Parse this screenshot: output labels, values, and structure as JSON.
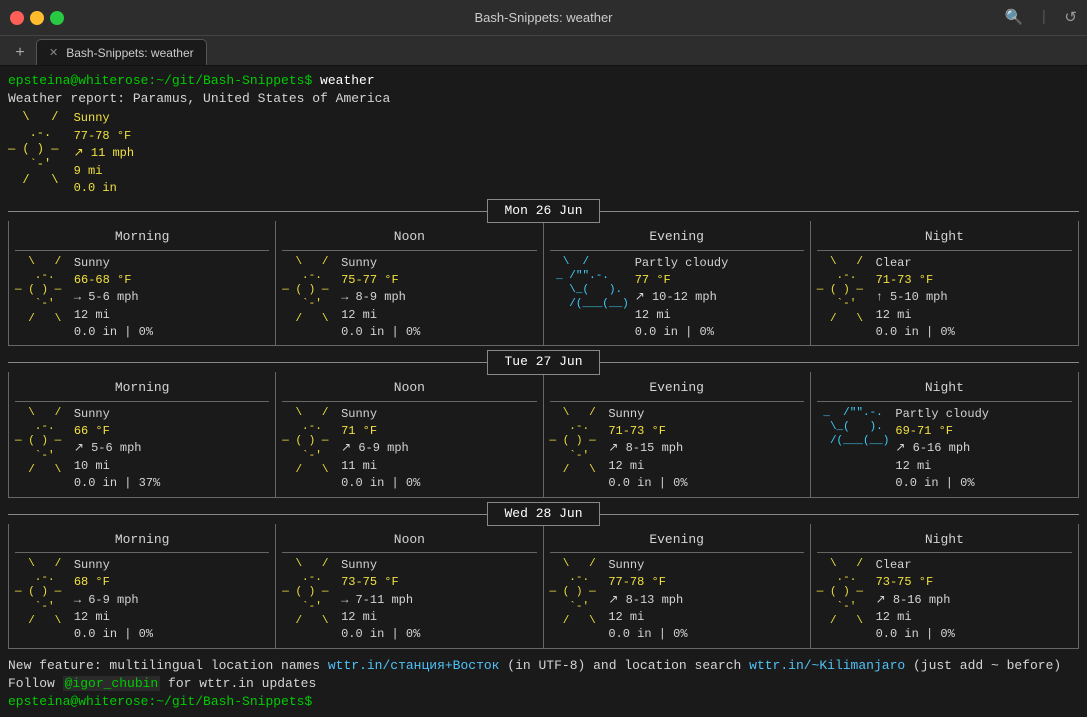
{
  "window": {
    "title": "Bash-Snippets: weather"
  },
  "tab": {
    "label": "Bash-Snippets: weather"
  },
  "terminal": {
    "prompt1": "epsteina@whiterose:~/git/Bash-Snippets$",
    "cmd1": " weather",
    "line1": "Weather report: Paramus, United States of America",
    "sunny_icon": "  \\   /\n   .-.  \n― ( ) ―\n   `-'  \n  /   \\",
    "header_info": "Sunny\n77-78 °F\n↗ 11 mph\n9 mi\n0.0 in"
  },
  "days": [
    {
      "label": "Mon 26 Jun",
      "cols": [
        {
          "header": "Morning",
          "icon_type": "sunny",
          "desc": "Sunny",
          "temp": "66-68 °F",
          "wind": "→ 5-6 mph",
          "vis": "12 mi",
          "rain": "0.0 in | 0%"
        },
        {
          "header": "Noon",
          "icon_type": "sunny",
          "desc": "Sunny",
          "temp": "75-77 °F",
          "wind": "→ 8-9 mph",
          "vis": "12 mi",
          "rain": "0.0 in | 0%"
        },
        {
          "header": "Evening",
          "icon_type": "partly",
          "desc": "Partly cloudy",
          "temp": "77 °F",
          "wind": "↗ 10-12 mph",
          "vis": "12 mi",
          "rain": "0.0 in | 0%"
        },
        {
          "header": "Night",
          "icon_type": "sunny",
          "desc": "Clear",
          "temp": "71-73 °F",
          "wind": "↑ 5-10 mph",
          "vis": "12 mi",
          "rain": "0.0 in | 0%"
        }
      ]
    },
    {
      "label": "Tue 27 Jun",
      "cols": [
        {
          "header": "Morning",
          "icon_type": "sunny",
          "desc": "Sunny",
          "temp": "66 °F",
          "wind": "↗ 5-6 mph",
          "vis": "10 mi",
          "rain": "0.0 in | 37%"
        },
        {
          "header": "Noon",
          "icon_type": "sunny",
          "desc": "Sunny",
          "temp": "71 °F",
          "wind": "↗ 6-9 mph",
          "vis": "11 mi",
          "rain": "0.0 in | 0%"
        },
        {
          "header": "Evening",
          "icon_type": "sunny",
          "desc": "Sunny",
          "temp": "71-73 °F",
          "wind": "↗ 8-15 mph",
          "vis": "12 mi",
          "rain": "0.0 in | 0%"
        },
        {
          "header": "Night",
          "icon_type": "partly",
          "desc": "Partly cloudy",
          "temp": "69-71 °F",
          "wind": "↗ 6-16 mph",
          "vis": "12 mi",
          "rain": "0.0 in | 0%"
        }
      ]
    },
    {
      "label": "Wed 28 Jun",
      "cols": [
        {
          "header": "Morning",
          "icon_type": "sunny",
          "desc": "Sunny",
          "temp": "68 °F",
          "wind": "→ 6-9 mph",
          "vis": "12 mi",
          "rain": "0.0 in | 0%"
        },
        {
          "header": "Noon",
          "icon_type": "sunny",
          "desc": "Sunny",
          "temp": "73-75 °F",
          "wind": "→ 7-11 mph",
          "vis": "12 mi",
          "rain": "0.0 in | 0%"
        },
        {
          "header": "Evening",
          "icon_type": "sunny",
          "desc": "Sunny",
          "temp": "77-78 °F",
          "wind": "↗ 8-13 mph",
          "vis": "12 mi",
          "rain": "0.0 in | 0%"
        },
        {
          "header": "Night",
          "icon_type": "sunny",
          "desc": "Clear",
          "temp": "73-75 °F",
          "wind": "↗ 8-16 mph",
          "vis": "12 mi",
          "rain": "0.0 in | 0%"
        }
      ]
    }
  ],
  "bottom": {
    "line1_prefix": "New feature: multilingual location names ",
    "link1": "wttr.in/станция+Восток",
    "line1_mid": " (in UTF-8) and location search ",
    "link2": "wttr.in/~Kilimanjaro",
    "line1_suffix": " (just add ~ before)",
    "line2_prefix": "Follow ",
    "handle": "@igor_chubin",
    "line2_suffix": " for wttr.in updates",
    "prompt": "epsteina@whiterose:~/git/Bash-Snippets$"
  }
}
